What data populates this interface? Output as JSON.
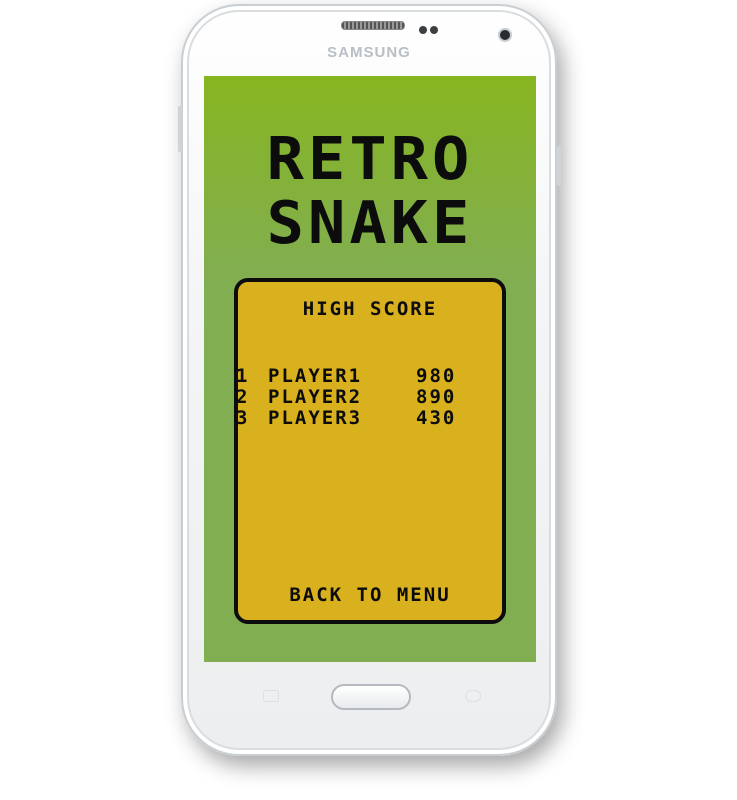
{
  "device": {
    "brand": "SAMSUNG",
    "icons": [
      "speaker-grille-icon",
      "proximity-sensor-icon",
      "front-camera-icon",
      "home-button-icon",
      "recent-apps-key-icon",
      "back-key-icon"
    ]
  },
  "game": {
    "title_line1": "RETRO",
    "title_line2": "SNAKE"
  },
  "high_score": {
    "heading": "HIGH SCORE",
    "entries": [
      {
        "rank": "1",
        "name": "PLAYER1",
        "score": "980"
      },
      {
        "rank": "2",
        "name": "PLAYER2",
        "score": "890"
      },
      {
        "rank": "3",
        "name": "PLAYER3",
        "score": "430"
      }
    ],
    "back_label": "BACK TO MENU"
  },
  "colors": {
    "screen_green": "#82ae52",
    "screen_top_green": "#86b520",
    "panel_yellow": "#d9b11e",
    "ink": "#0c0c0c"
  }
}
